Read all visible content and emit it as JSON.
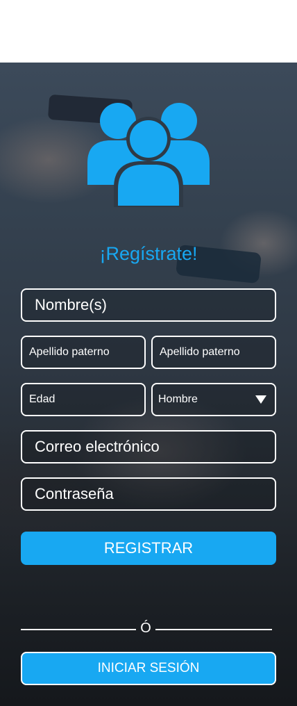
{
  "colors": {
    "accent": "#18a8f2",
    "field_border": "#ffffff",
    "text": "#ffffff"
  },
  "logo": {
    "icon": "users-group-icon"
  },
  "title": "¡Regístrate!",
  "form": {
    "nombre_placeholder": "Nombre(s)",
    "apellido_paterno_placeholder": "Apellido paterno",
    "apellido_materno_placeholder": "Apellido paterno",
    "edad_placeholder": "Edad",
    "sexo_selected": "Hombre",
    "correo_placeholder": "Correo electrónico",
    "contrasena_placeholder": "Contraseña"
  },
  "register_button": "REGISTRAR",
  "divider_text": "Ó",
  "login_button": "INICIAR SESIÓN"
}
